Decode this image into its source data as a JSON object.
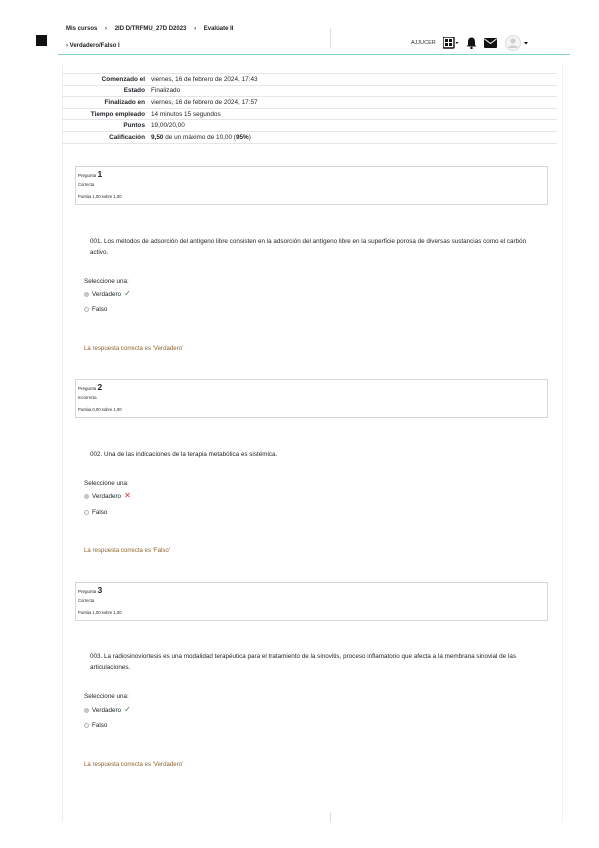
{
  "header": {
    "breadcrumb": [
      "Mis cursos",
      "2ID D/TRFMU_27D D2023",
      "Evalúate II"
    ],
    "separator": "›",
    "subtitle": "Verdadero/Falso I",
    "user": "AJJUCER"
  },
  "summary": [
    {
      "label": "Comenzado el",
      "value": "viernes, 16 de febrero de 2024, 17:43"
    },
    {
      "label": "Estado",
      "value": "Finalizado"
    },
    {
      "label": "Finalizado en",
      "value": "viernes, 16 de febrero de 2024, 17:57"
    },
    {
      "label": "Tiempo empleado",
      "value": "14 minutos 15 segundos"
    },
    {
      "label": "Puntos",
      "value": "19,00/20,00"
    }
  ],
  "grade": {
    "label": "Calificación",
    "score": "9,50",
    "middle": "de un máximo de 10,00",
    "percent": "95%"
  },
  "questions": [
    {
      "label": "Pregunta",
      "number": "1",
      "status": "Correcta",
      "points": "Puntúa 1,00 sobre 1,00",
      "text": "001. Los métodos de adsorción del antígeno libre consisten en la adsorción del antígeno libre en la superficie porosa de diversas sustancias como el carbón activo.",
      "prompt": "Seleccione una:",
      "options": [
        "Verdadero",
        "Falso"
      ],
      "feedback": "La respuesta correcta es 'Verdadero'"
    },
    {
      "label": "Pregunta",
      "number": "2",
      "status": "Incorrecta",
      "points": "Puntúa 0,00 sobre 1,00",
      "text": "002. Una de las indicaciones de la terapia metabólica es sistémica.",
      "prompt": "Seleccione una:",
      "options": [
        "Verdadero",
        "Falso"
      ],
      "feedback": "La respuesta correcta es 'Falso'"
    },
    {
      "label": "Pregunta",
      "number": "3",
      "status": "Correcta",
      "points": "Puntúa 1,00 sobre 1,00",
      "text": "003. La radiosinoviortesis es una modalidad terapéutica para el tratamiento de la sinovitis, proceso inflamatorio que afecta a la membrana sinovial de las articulaciones.",
      "prompt": "Seleccione una:",
      "options": [
        "Verdadero",
        "Falso"
      ],
      "feedback": "La respuesta correcta es 'Verdadero'"
    }
  ],
  "marks": {
    "correct": "✓",
    "incorrect": "✕"
  },
  "colors": {
    "accent_line": "#7fd3cb",
    "feedback": "#8e662e",
    "correct": "#3c7a36",
    "incorrect": "#ca2e2e"
  }
}
